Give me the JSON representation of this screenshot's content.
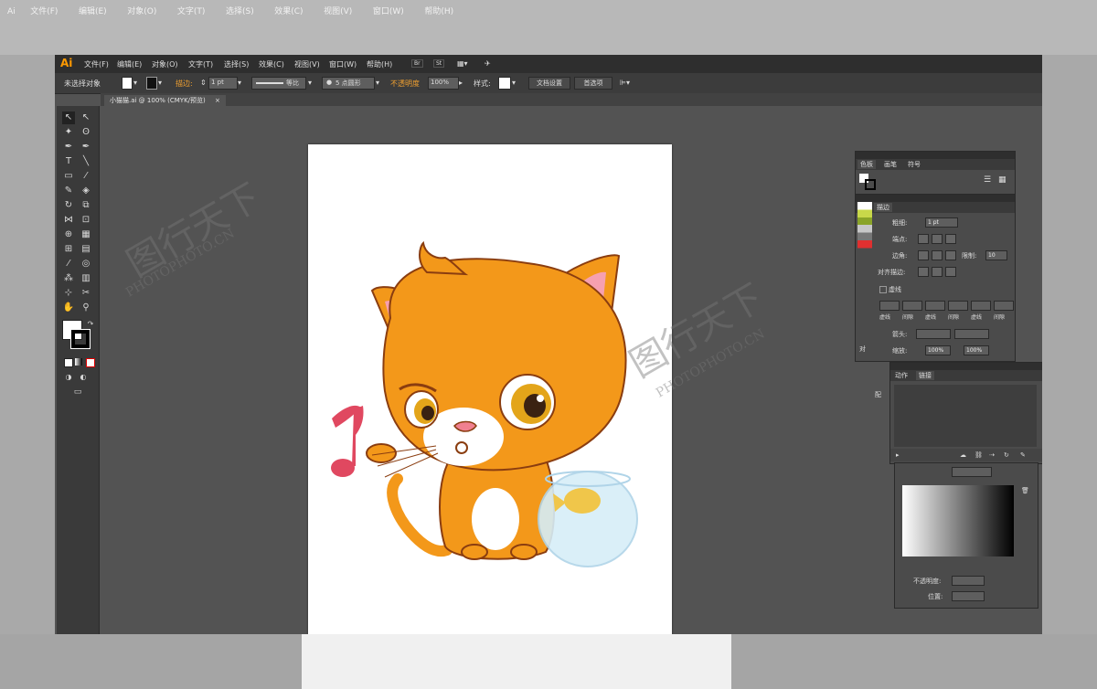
{
  "app": {
    "logo": "Ai"
  },
  "menu": [
    "文件(F)",
    "编辑(E)",
    "对象(O)",
    "文字(T)",
    "选择(S)",
    "效果(C)",
    "视图(V)",
    "窗口(W)",
    "帮助(H)"
  ],
  "menu_icons": {
    "bridge": "Br",
    "stock": "St"
  },
  "control": {
    "selection_status": "未选择对象",
    "stroke_label": "描边:",
    "stroke_weight": "1 pt",
    "stroke_profile": "等比",
    "brush": "5 点圆形",
    "opacity_label": "不透明度",
    "opacity_value": "100%",
    "style_label": "样式:",
    "doc_setup": "文档设置",
    "preferences": "首选项"
  },
  "document_tab": {
    "title": "小猫猫.ai @ 100% (CMYK/预览)"
  },
  "swatches_panel": {
    "tabs": [
      "色板",
      "画笔",
      "符号"
    ]
  },
  "stroke_panel": {
    "tab": "描边",
    "weight_label": "粗细:",
    "weight_value": "1 pt",
    "cap_label": "端点:",
    "corner_label": "边角:",
    "limit_label": "限制:",
    "limit_value": "10",
    "align_label": "对齐描边:",
    "dashed_label": "虚线",
    "dash_fields": [
      "虚线",
      "间隙",
      "虚线",
      "间隙",
      "虚线",
      "间隙"
    ],
    "arrow_label": "箭头:",
    "scale_label": "缩放:",
    "scale_values": [
      "100%",
      "100%"
    ],
    "align_short": "对",
    "profile_short": "配"
  },
  "actions_panel": {
    "tabs": [
      "动作",
      "链接"
    ]
  },
  "gradient_panel": {
    "opacity_label": "不透明度:",
    "position_label": "位置:"
  },
  "watermark": {
    "brand": "图行天下",
    "domain": "PHOTOPHOTO.CN"
  },
  "bg_menu": [
    "文件(F)",
    "编辑(E)",
    "对象(O)",
    "文字(T)",
    "选择(S)",
    "效果(C)",
    "视图(V)",
    "窗口(W)",
    "帮助(H)"
  ]
}
